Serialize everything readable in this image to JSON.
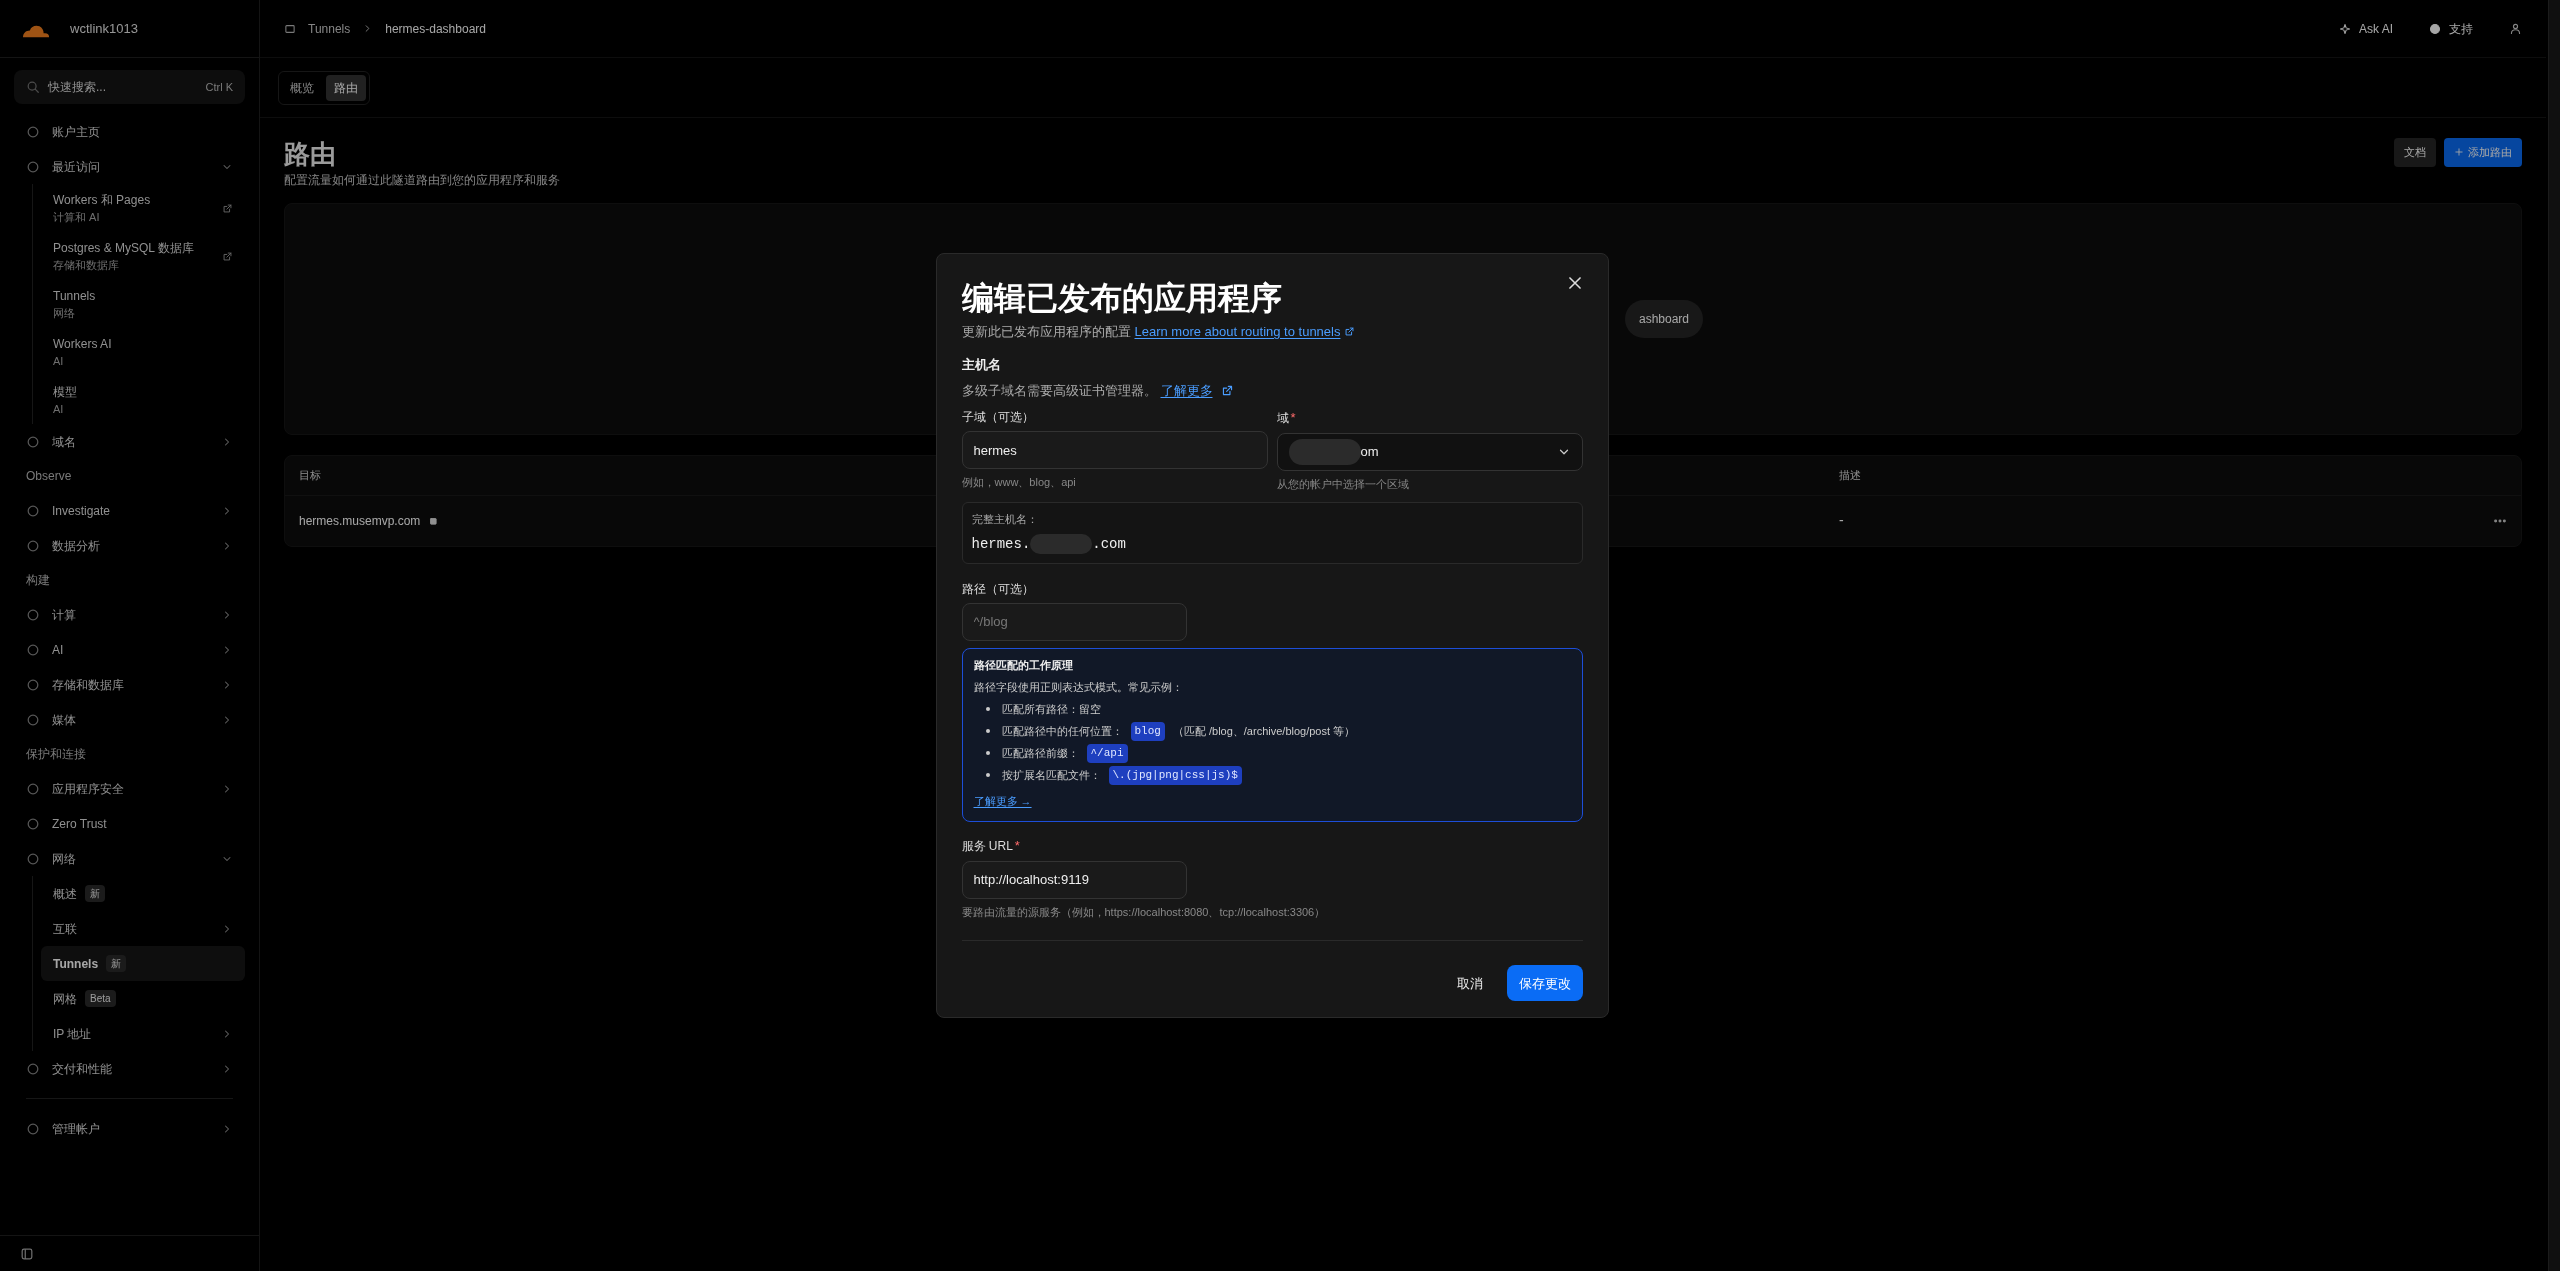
{
  "sidebar": {
    "account": "wctlink1013",
    "search": {
      "placeholder": "快速搜索...",
      "shortcut": "Ctrl K"
    },
    "items": [
      {
        "kind": "item",
        "label": "账户主页"
      },
      {
        "kind": "item",
        "label": "最近访问",
        "expanded": true,
        "children": [
          {
            "label": "Workers 和 Pages",
            "sublabel": "计算和 AI",
            "external": true
          },
          {
            "label": "Postgres & MySQL 数据库",
            "sublabel": "存储和数据库",
            "external": true
          },
          {
            "label": "Tunnels",
            "sublabel": "网络"
          },
          {
            "label": "Workers AI",
            "sublabel": "AI"
          },
          {
            "label": "模型",
            "sublabel": "AI"
          }
        ]
      },
      {
        "kind": "item",
        "label": "域名",
        "expanded": false
      },
      {
        "kind": "section",
        "label": "Observe"
      },
      {
        "kind": "item",
        "label": "Investigate",
        "expanded": false
      },
      {
        "kind": "item",
        "label": "数据分析",
        "expanded": false
      },
      {
        "kind": "section",
        "label": "构建"
      },
      {
        "kind": "item",
        "label": "计算",
        "expanded": false
      },
      {
        "kind": "item",
        "label": "AI",
        "expanded": false
      },
      {
        "kind": "item",
        "label": "存储和数据库",
        "expanded": false
      },
      {
        "kind": "item",
        "label": "媒体",
        "expanded": false
      },
      {
        "kind": "section",
        "label": "保护和连接"
      },
      {
        "kind": "item",
        "label": "应用程序安全",
        "expanded": false
      },
      {
        "kind": "item",
        "label": "Zero Trust"
      },
      {
        "kind": "item",
        "label": "网络",
        "expanded": true,
        "children": [
          {
            "label": "概述",
            "badge": "新",
            "selected": false
          },
          {
            "label": "互联",
            "expanded": false,
            "selected": false
          },
          {
            "label": "Tunnels",
            "badge": "新",
            "selected": true
          },
          {
            "label": "网格",
            "badge": "Beta",
            "selected": false
          },
          {
            "label": "IP 地址",
            "expanded": false,
            "selected": false
          }
        ]
      },
      {
        "kind": "item",
        "label": "交付和性能",
        "expanded": false
      },
      {
        "kind": "divider"
      },
      {
        "kind": "item",
        "label": "管理帐户",
        "expanded": false
      }
    ]
  },
  "topbar": {
    "breadcrumb": [
      "Tunnels",
      "hermes-dashboard"
    ],
    "ask_ai": "Ask AI",
    "support": "支持"
  },
  "tabs": [
    {
      "label": "概览",
      "selected": false
    },
    {
      "label": "路由",
      "selected": true
    }
  ],
  "page": {
    "title": "路由",
    "subtitle": "配置流量如何通过此隧道路由到您的应用程序和服务",
    "docs_button": "文档",
    "add_button": "添加路由",
    "panel_pill": "ashboard",
    "table": {
      "columns": [
        "目标",
        "描述"
      ],
      "rows": [
        {
          "target": "hermes.musemvp.com",
          "description": "-"
        }
      ]
    }
  },
  "modal": {
    "title": "编辑已发布的应用程序",
    "subtitle": "更新此已发布应用程序的配置",
    "subtitle_link": "Learn more about routing to tunnels",
    "hostname": {
      "heading": "主机名",
      "note": "多级子域名需要高级证书管理器。",
      "note_link": "了解更多"
    },
    "subdomain": {
      "label": "子域（可选）",
      "value": "hermes",
      "hint": "例如，www、blog、api"
    },
    "domain": {
      "label": "域",
      "required_mark": "*",
      "value": "om",
      "hint": "从您的帐户中选择一个区域"
    },
    "full_hostname": {
      "label": "完整主机名：",
      "prefix": "hermes.",
      "suffix": ".com"
    },
    "path": {
      "label": "路径（可选）",
      "placeholder": "^/blog"
    },
    "info": {
      "title": "路径匹配的工作原理",
      "intro": "路径字段使用正则表达式模式。常见示例：",
      "items": [
        {
          "text": "匹配所有路径：留空"
        },
        {
          "text": "匹配路径中的任何位置：",
          "code": "blog",
          "note": "（匹配 /blog、/archive/blog/post 等）"
        },
        {
          "text": "匹配路径前缀：",
          "code": "^/api"
        },
        {
          "text": "按扩展名匹配文件：",
          "code": "\\.(jpg|png|css|js)$"
        }
      ],
      "link": "了解更多 →"
    },
    "service": {
      "label": "服务 URL",
      "required_mark": "*",
      "value": "http://localhost:9119",
      "hint": "要路由流量的源服务（例如，https://localhost:8080、tcp://localhost:3306）"
    },
    "buttons": [
      {
        "label": "取消",
        "kind": "secondary"
      },
      {
        "label": "保存更改",
        "kind": "primary"
      }
    ]
  }
}
